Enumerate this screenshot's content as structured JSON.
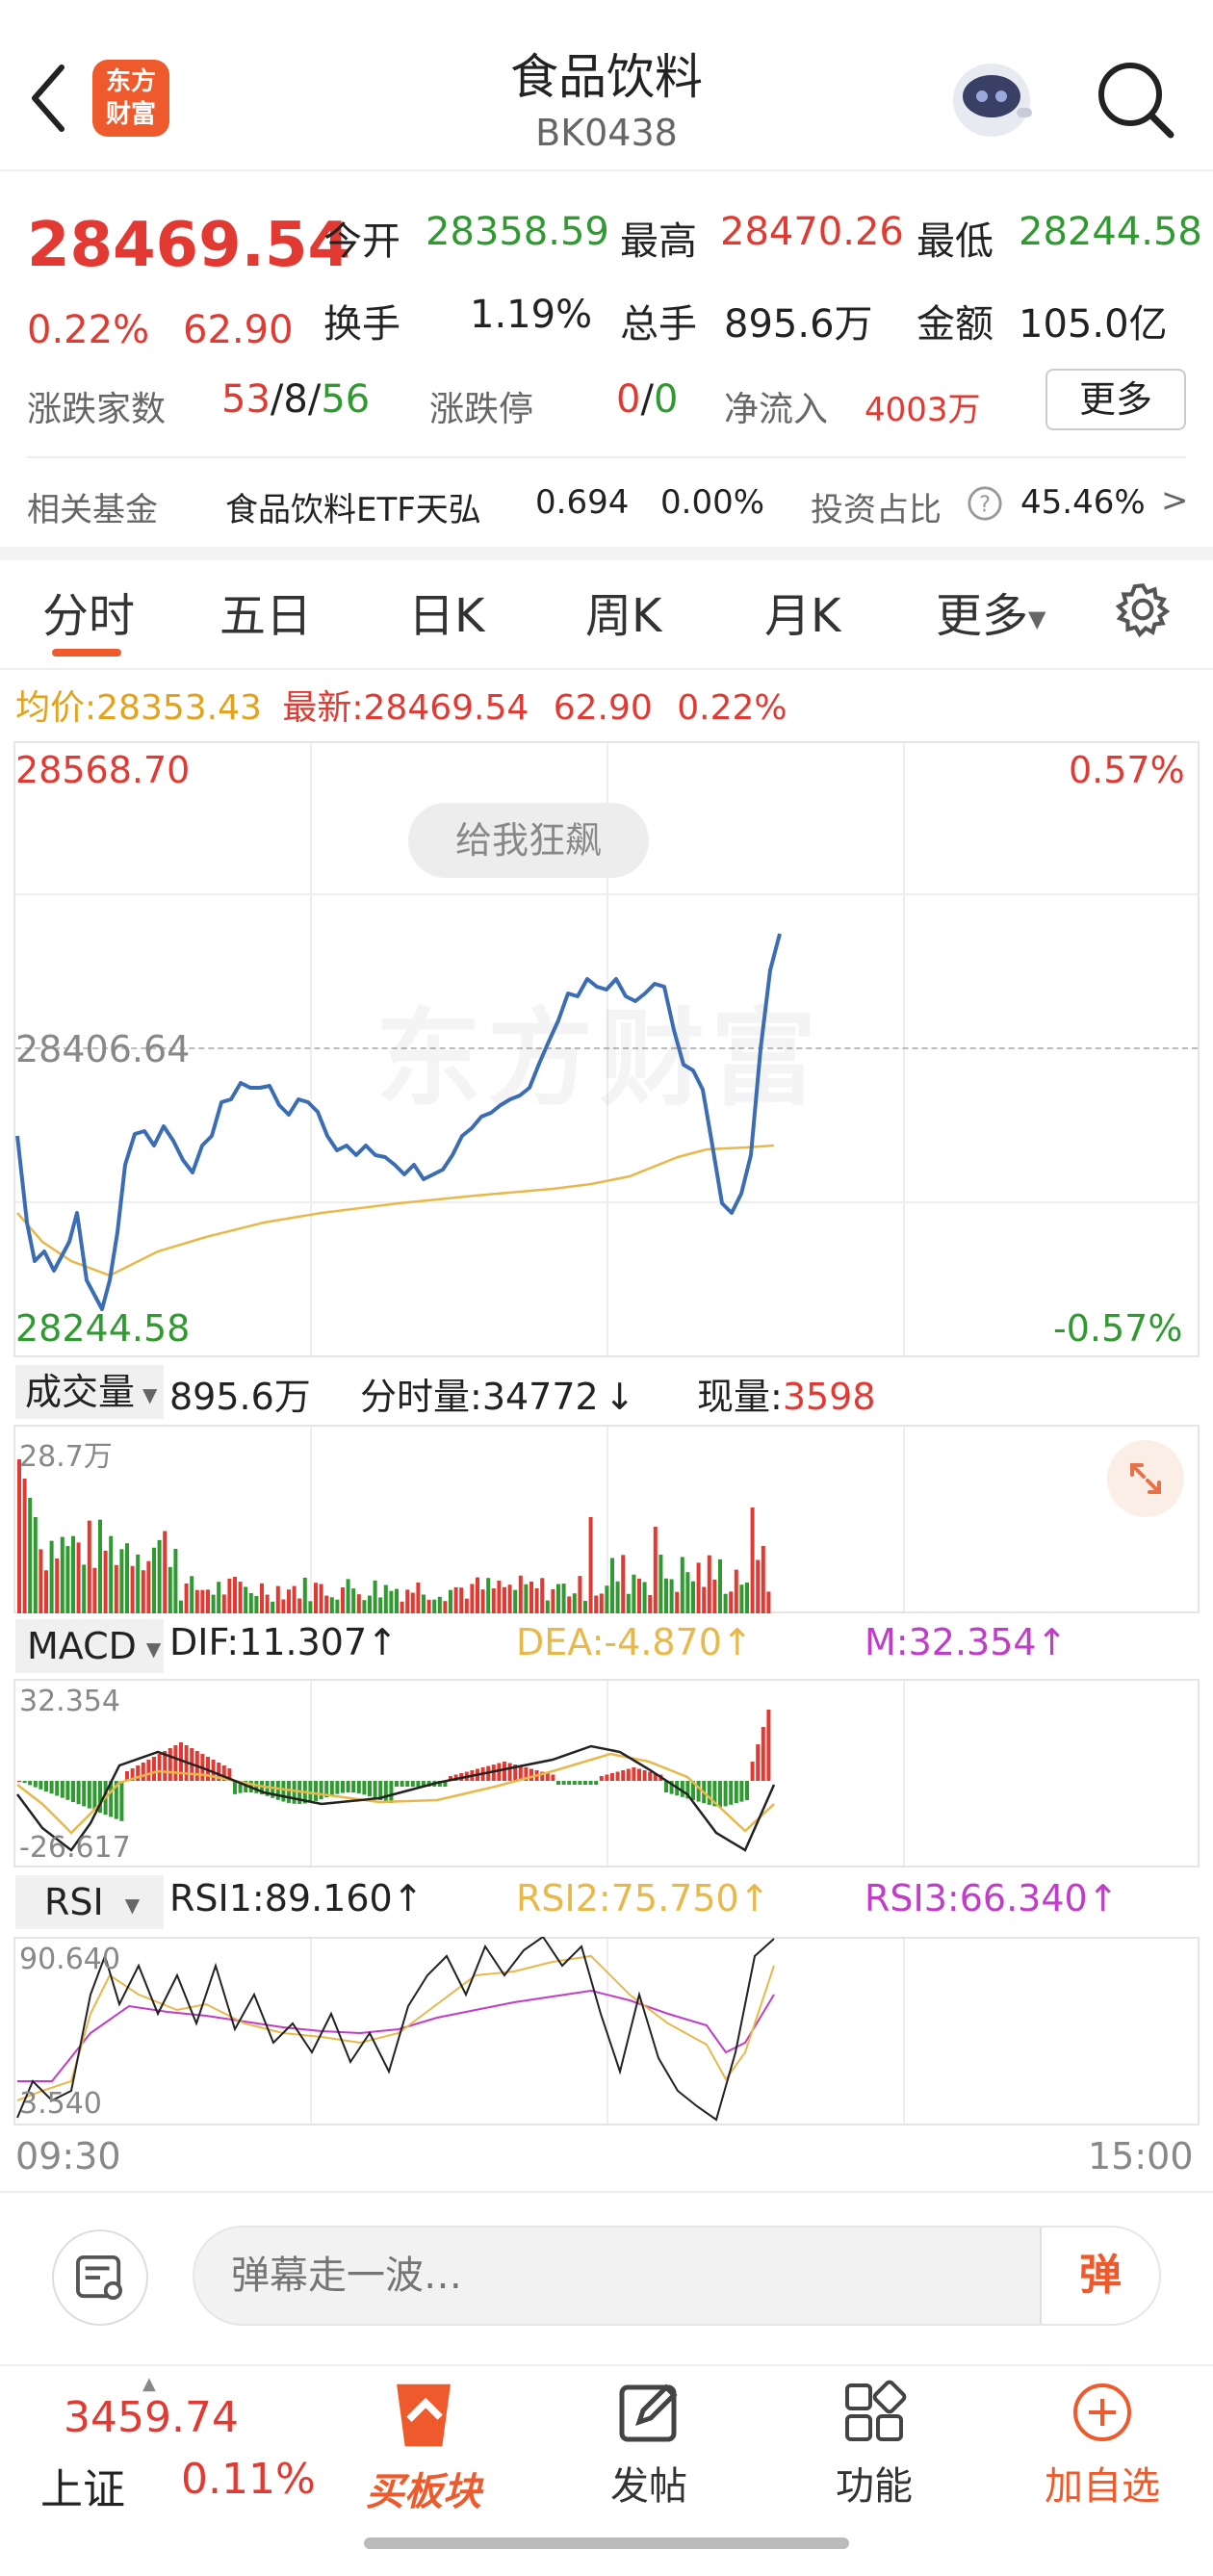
{
  "header": {
    "title": "食品饮料",
    "code": "BK0438",
    "logo_text": "东方财富"
  },
  "quote": {
    "price": "28469.54",
    "change_pct": "0.22%",
    "change": "62.90",
    "open_label": "今开",
    "open": "28358.59",
    "high_label": "最高",
    "high": "28470.26",
    "low_label": "最低",
    "low": "28244.58",
    "turnover_label": "换手",
    "turnover": "1.19%",
    "volume_label": "总手",
    "volume": "895.6万",
    "amount_label": "金额",
    "amount": "105.0亿",
    "breadth_label": "涨跌家数",
    "up": "53",
    "flat": "8",
    "down": "56",
    "limit_label": "涨跌停",
    "limit_up": "0",
    "limit_down": "0",
    "netflow_label": "净流入",
    "netflow": "4003万",
    "more_label": "更多"
  },
  "fund": {
    "label": "相关基金",
    "name": "食品饮料ETF天弘",
    "price": "0.694",
    "change": "0.00%",
    "ratio_label": "投资占比",
    "ratio": "45.46%",
    "arrow": ">"
  },
  "tabs": {
    "items": [
      "分时",
      "五日",
      "日K",
      "周K",
      "月K",
      "更多"
    ],
    "active": 0
  },
  "info_line": {
    "avg_label": "均价:",
    "avg": "28353.43",
    "last_label": "最新:",
    "last": "28469.54",
    "change": "62.90",
    "pct": "0.22%"
  },
  "price_chart": {
    "max": "28568.70",
    "max_pct": "0.57%",
    "mid": "28406.64",
    "min": "28244.58",
    "min_pct": "-0.57%",
    "boost_button": "给我狂飙"
  },
  "volume_panel": {
    "label": "成交量",
    "total": "895.6万",
    "minute_label": "分时量:",
    "minute": "34772",
    "minute_arrow": "↓",
    "current_label": "现量:",
    "current": "3598",
    "scale": "28.7万"
  },
  "macd_panel": {
    "label": "MACD",
    "dif": "DIF:11.307",
    "dea": "DEA:-4.870",
    "m": "M:32.354",
    "up_arrow": "↑",
    "max": "32.354",
    "min": "-26.617"
  },
  "rsi_panel": {
    "label": "RSI",
    "rsi1": "RSI1:89.160",
    "rsi2": "RSI2:75.750",
    "rsi3": "RSI3:66.340",
    "up_arrow": "↑",
    "max": "90.640",
    "min": "3.540"
  },
  "time_axis": {
    "start": "09:30",
    "end": "15:00"
  },
  "comment": {
    "placeholder": "弹幕走一波…",
    "danmu_button": "弹"
  },
  "bottom_nav": {
    "index_value": "3459.74",
    "index_name": "上证",
    "index_pct": "0.11%",
    "buy_label": "买板块",
    "post_label": "发帖",
    "func_label": "功能",
    "watch_label": "加自选"
  },
  "colors": {
    "up": "#e23a32",
    "down": "#2f9a2f",
    "price_line": "#3b6db5",
    "avg_line": "#e8b84a",
    "accent": "#ef5a2c"
  }
}
